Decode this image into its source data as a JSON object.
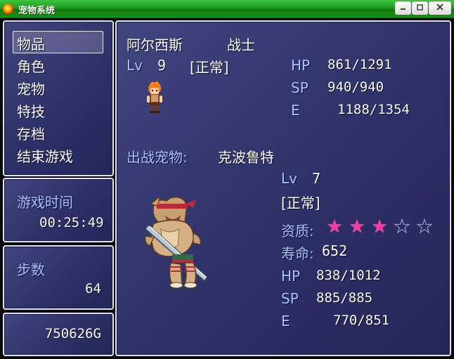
{
  "window": {
    "title": "宠物系统",
    "controls": [
      "minimize",
      "restore",
      "close"
    ]
  },
  "menu": {
    "items": [
      {
        "label": "物品",
        "selected": true
      },
      {
        "label": "角色",
        "selected": false
      },
      {
        "label": "宠物",
        "selected": false
      },
      {
        "label": "特技",
        "selected": false
      },
      {
        "label": "存档",
        "selected": false
      },
      {
        "label": "结束游戏",
        "selected": false
      }
    ]
  },
  "playtime": {
    "label": "游戏时间",
    "value": "00:25:49"
  },
  "steps": {
    "label": "步数",
    "value": "64"
  },
  "gold": {
    "value": "750626G"
  },
  "hero": {
    "name": "阿尔西斯",
    "class": "战士",
    "lv_label": "Lv",
    "lv": "9",
    "status": "[正常]",
    "hp_label": "HP",
    "hp": "861/1291",
    "sp_label": "SP",
    "sp": "940/940",
    "e_label": "E",
    "e": "1188/1354"
  },
  "pet": {
    "heading": "出战宠物:",
    "name": "克波鲁特",
    "lv_label": "Lv",
    "lv": "7",
    "status": "[正常]",
    "quality_label": "资质:",
    "quality_stars": 3,
    "quality_max": 5,
    "life_label": "寿命:",
    "life": "652",
    "hp_label": "HP",
    "hp": "838/1012",
    "sp_label": "SP",
    "sp": "885/885",
    "e_label": "E",
    "e": "770/851"
  },
  "colors": {
    "titlebar": "#1f9a1f",
    "panel": "#2e3068",
    "panel_border": "#dfe3f2",
    "label_blue": "#a9c3ff",
    "star_on": "#ff3aa0"
  }
}
